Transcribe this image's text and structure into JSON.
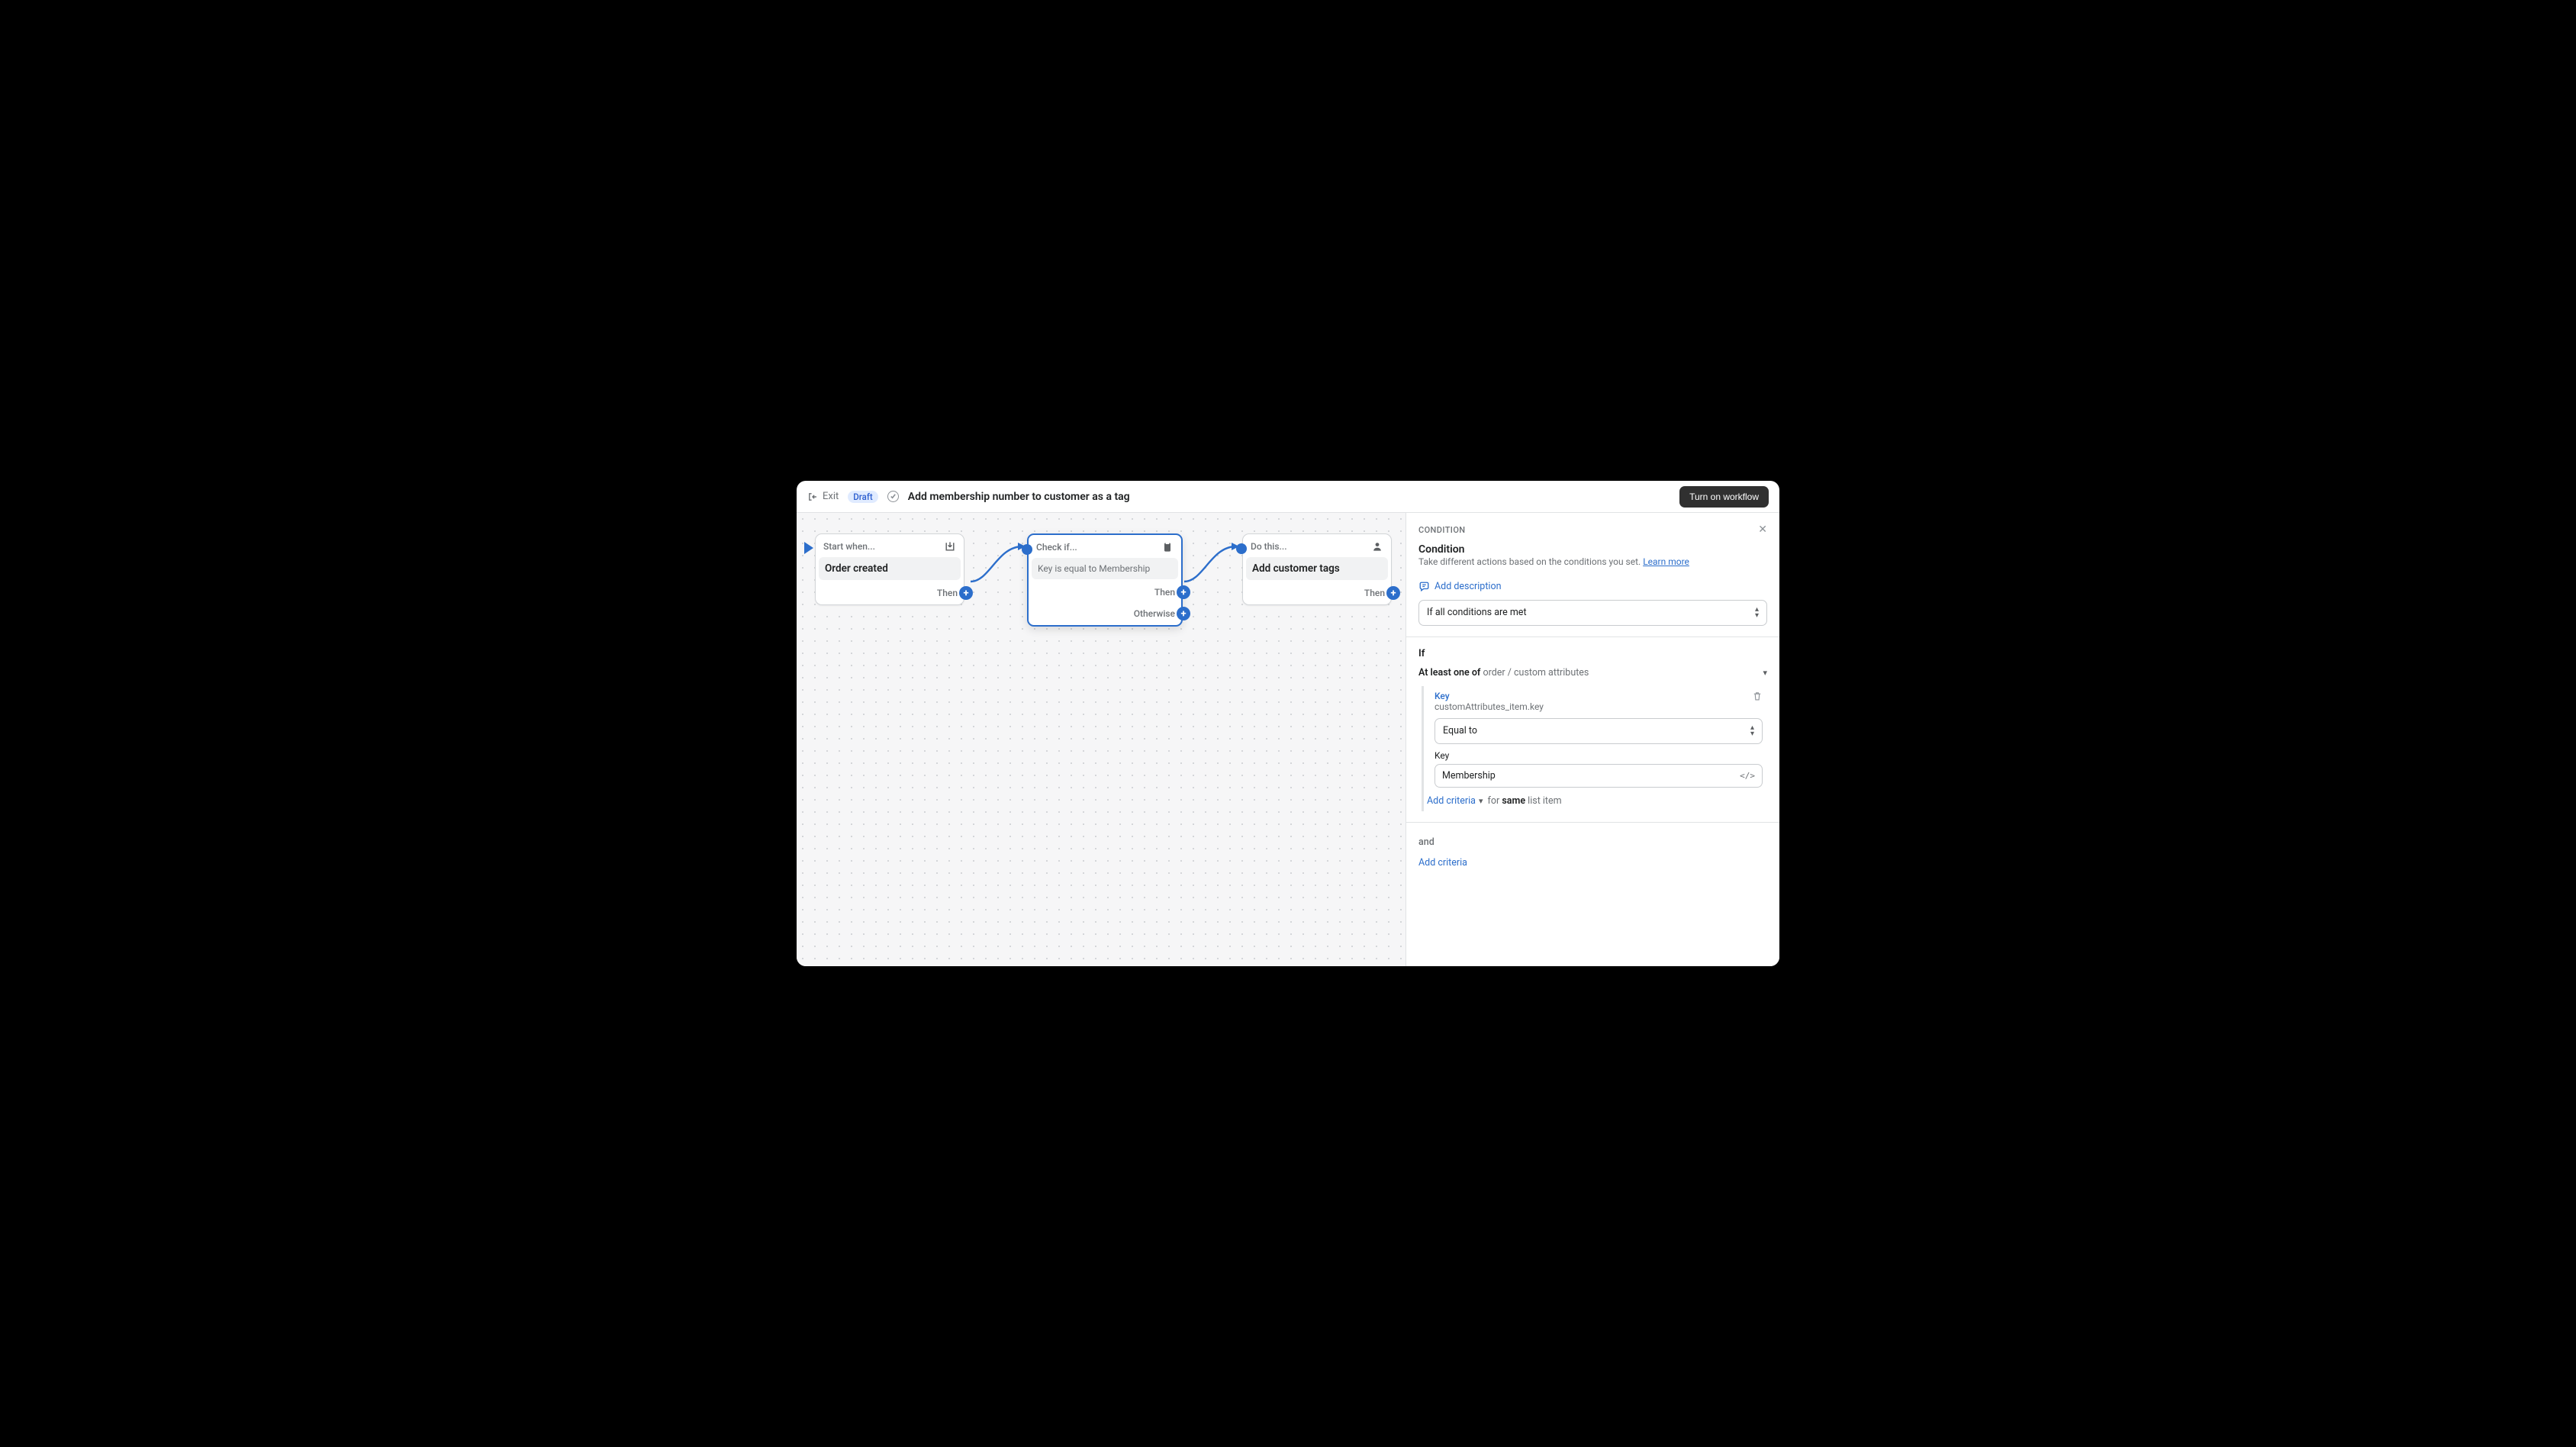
{
  "header": {
    "exit": "Exit",
    "status": "Draft",
    "title": "Add membership number to customer as a tag",
    "turn_on": "Turn on workflow"
  },
  "nodes": {
    "start": {
      "head": "Start when...",
      "title": "Order created",
      "port_then": "Then"
    },
    "check": {
      "head": "Check if...",
      "sub": "Key is equal to Membership",
      "port_then": "Then",
      "port_otherwise": "Otherwise"
    },
    "action": {
      "head": "Do this...",
      "title": "Add customer tags",
      "port_then": "Then"
    }
  },
  "panel": {
    "eyebrow": "CONDITION",
    "title": "Condition",
    "desc": "Take different actions based on the conditions you set. ",
    "learn_more": "Learn more",
    "add_desc": "Add description",
    "match_rule": "If all conditions are met",
    "if_label": "If",
    "rule_prefix": "At least one of",
    "rule_path": "order / custom attributes",
    "crit_key_label": "Key",
    "crit_key_path": "customAttributes_item.key",
    "operator": "Equal to",
    "value_label": "Key",
    "value": "Membership",
    "add_criteria": "Add criteria",
    "same_hint_for": "for",
    "same_hint_same": "same",
    "same_hint_rest": "list item",
    "and_label": "and",
    "add_criteria2": "Add criteria"
  }
}
